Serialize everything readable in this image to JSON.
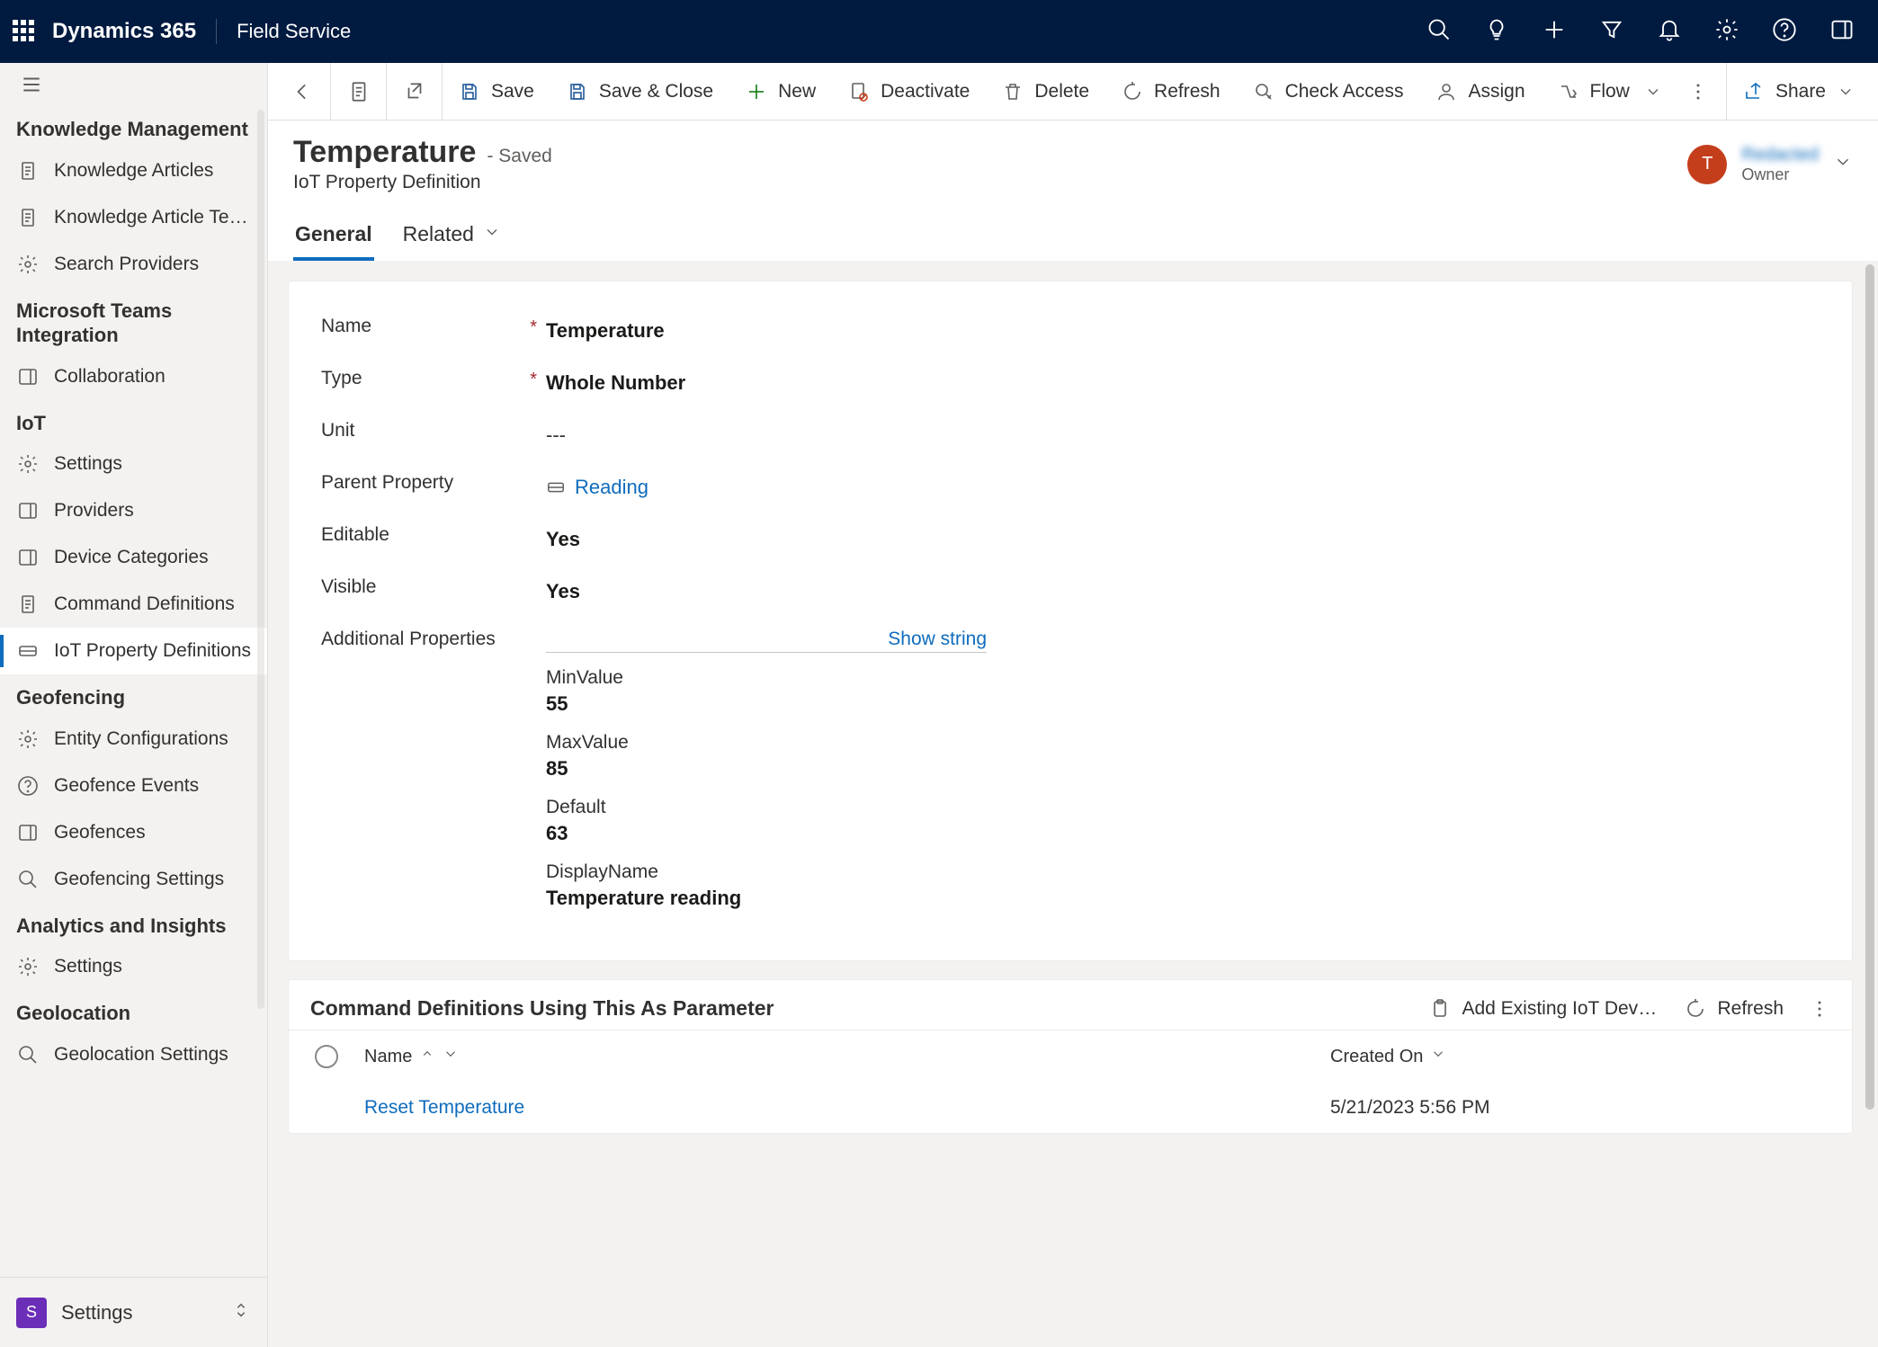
{
  "top": {
    "brand": "Dynamics 365",
    "app": "Field Service"
  },
  "sidebar": {
    "sections": [
      {
        "label": "Knowledge Management",
        "items": [
          {
            "icon": "doc",
            "label": "Knowledge Articles"
          },
          {
            "icon": "doc",
            "label": "Knowledge Article Templates"
          },
          {
            "icon": "search-settings",
            "label": "Search Providers"
          }
        ]
      },
      {
        "label": "Microsoft Teams Integration",
        "items": [
          {
            "icon": "chat",
            "label": "Collaboration"
          }
        ]
      },
      {
        "label": "IoT",
        "items": [
          {
            "icon": "sliders",
            "label": "Settings"
          },
          {
            "icon": "cloud",
            "label": "Providers"
          },
          {
            "icon": "chip",
            "label": "Device Categories"
          },
          {
            "icon": "list",
            "label": "Command Definitions"
          },
          {
            "icon": "prop",
            "label": "IoT Property Definitions",
            "selected": true
          }
        ]
      },
      {
        "label": "Geofencing",
        "items": [
          {
            "icon": "gear",
            "label": "Entity Configurations"
          },
          {
            "icon": "alert",
            "label": "Geofence Events"
          },
          {
            "icon": "fence",
            "label": "Geofences"
          },
          {
            "icon": "target",
            "label": "Geofencing Settings"
          }
        ]
      },
      {
        "label": "Analytics and Insights",
        "items": [
          {
            "icon": "gear",
            "label": "Settings"
          }
        ]
      },
      {
        "label": "Geolocation",
        "items": [
          {
            "icon": "marker",
            "label": "Geolocation Settings"
          }
        ]
      }
    ],
    "area": {
      "tile": "S",
      "label": "Settings"
    }
  },
  "commands": {
    "back": "Back",
    "save": "Save",
    "saveclose": "Save & Close",
    "new": "New",
    "deactivate": "Deactivate",
    "delete": "Delete",
    "refresh": "Refresh",
    "checkaccess": "Check Access",
    "assign": "Assign",
    "flow": "Flow",
    "share": "Share"
  },
  "record": {
    "title": "Temperature",
    "status": "- Saved",
    "subtitle": "IoT Property Definition",
    "tabs": {
      "general": "General",
      "related": "Related"
    },
    "owner": {
      "initial": "T",
      "name": "Redacted",
      "role": "Owner"
    }
  },
  "fields": {
    "name_label": "Name",
    "name_value": "Temperature",
    "type_label": "Type",
    "type_value": "Whole Number",
    "unit_label": "Unit",
    "unit_value": "---",
    "parent_label": "Parent Property",
    "parent_value": "Reading",
    "editable_label": "Editable",
    "editable_value": "Yes",
    "visible_label": "Visible",
    "visible_value": "Yes",
    "addprops_label": "Additional Properties",
    "showstring": "Show string",
    "addprops": [
      {
        "lbl": "MinValue",
        "val": "55"
      },
      {
        "lbl": "MaxValue",
        "val": "85"
      },
      {
        "lbl": "Default",
        "val": "63"
      },
      {
        "lbl": "DisplayName",
        "val": "Temperature reading"
      }
    ]
  },
  "subgrid": {
    "title": "Command Definitions Using This As Parameter",
    "add": "Add Existing IoT Device Command Definition",
    "refresh": "Refresh",
    "cols": {
      "name": "Name",
      "created": "Created On"
    },
    "rows": [
      {
        "name": "Reset Temperature",
        "created": "5/21/2023 5:56 PM"
      }
    ]
  }
}
